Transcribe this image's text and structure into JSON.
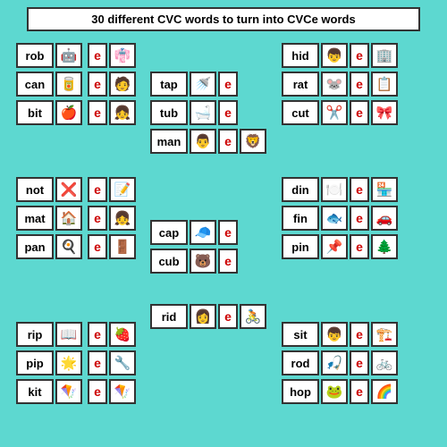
{
  "title": "30 different CVC words to turn into CVCe words",
  "rows": [
    {
      "group": "top-left",
      "words": [
        {
          "word": "rob",
          "icon": "🤖"
        },
        {
          "word": "can",
          "icon": "🥫"
        },
        {
          "word": "bit",
          "icon": "🍎"
        }
      ]
    },
    {
      "group": "top-middle",
      "words": [
        {
          "word": "tap",
          "icon": "🚿"
        },
        {
          "word": "tub",
          "icon": "🛁"
        },
        {
          "word": "man",
          "icon": "👨"
        }
      ]
    },
    {
      "group": "top-right",
      "words": [
        {
          "word": "hid",
          "icon": "👦"
        },
        {
          "word": "rat",
          "icon": "🐭"
        },
        {
          "word": "cut",
          "icon": "✂️"
        }
      ]
    },
    {
      "group": "mid-left",
      "words": [
        {
          "word": "not",
          "icon": "❌"
        },
        {
          "word": "mat",
          "icon": "🏠"
        },
        {
          "word": "pan",
          "icon": "🍳"
        }
      ]
    },
    {
      "group": "mid-center",
      "words": [
        {
          "word": "cap",
          "icon": "🧢"
        },
        {
          "word": "cub",
          "icon": "🐻"
        }
      ]
    },
    {
      "group": "mid-right",
      "words": [
        {
          "word": "din",
          "icon": "🍽️"
        },
        {
          "word": "fin",
          "icon": "🐟"
        },
        {
          "word": "pin",
          "icon": "📌"
        }
      ]
    },
    {
      "group": "bot-left",
      "words": [
        {
          "word": "rip",
          "icon": "📖"
        },
        {
          "word": "pip",
          "icon": "🌟"
        },
        {
          "word": "kit",
          "icon": "🪁"
        }
      ]
    },
    {
      "group": "bot-center",
      "words": [
        {
          "word": "rid",
          "icon": "👩"
        }
      ]
    },
    {
      "group": "bot-right",
      "words": [
        {
          "word": "sit",
          "icon": "👦"
        },
        {
          "word": "rod",
          "icon": "🎣"
        },
        {
          "word": "hop",
          "icon": "🐸"
        }
      ]
    }
  ],
  "colors": {
    "background": "#5dd8d0",
    "card_border": "#333333",
    "e_color": "#cc0000",
    "title_bg": "#ffffff"
  }
}
